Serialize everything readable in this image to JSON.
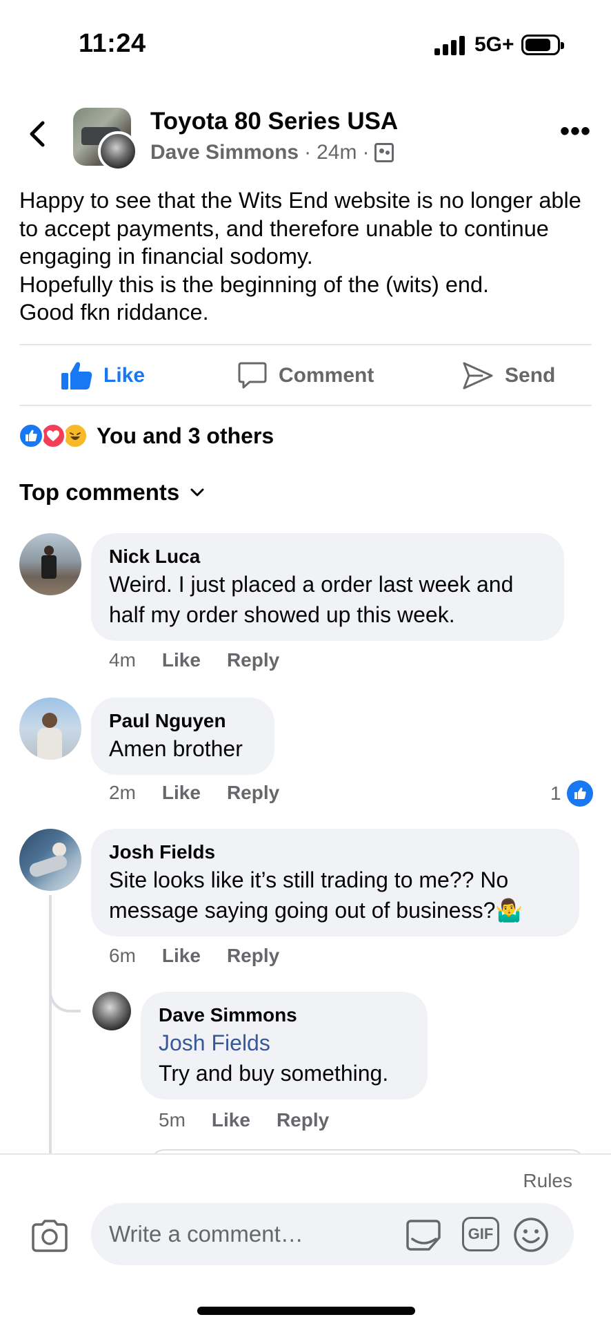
{
  "status_bar": {
    "time": "11:24",
    "network": "5G+"
  },
  "post": {
    "group_name": "Toyota 80 Series USA",
    "author": "Dave Simmons",
    "time": "24m",
    "separator": "·",
    "more_label": "•••",
    "text": "Happy to see that the Wits End website is no longer able to accept payments, and therefore unable to continue engaging in financial sodomy.\nHopefully this is the beginning of the (wits) end.\nGood fkn riddance."
  },
  "actions": {
    "like": "Like",
    "comment": "Comment",
    "send": "Send",
    "like_active": true
  },
  "reactions": {
    "summary": "You and 3 others",
    "types": [
      "like",
      "love",
      "haha"
    ]
  },
  "comments_header": {
    "label": "Top comments"
  },
  "comments": [
    {
      "name": "Nick Luca",
      "text": "Weird. I just placed a order last week and half my order showed up this week.",
      "time": "4m",
      "like": "Like",
      "reply": "Reply"
    },
    {
      "name": "Paul Nguyen",
      "text": "Amen brother",
      "time": "2m",
      "like": "Like",
      "reply": "Reply",
      "reaction_count": "1"
    },
    {
      "name": "Josh Fields",
      "text": "Site looks like it’s still trading to me?? No message saying going out of business?🤷‍♂️",
      "time": "6m",
      "like": "Like",
      "reply": "Reply"
    }
  ],
  "reply": {
    "name": "Dave Simmons",
    "mention": "Josh Fields",
    "text": "Try and buy something.",
    "time": "5m",
    "like": "Like",
    "reply": "Reply"
  },
  "composer": {
    "rules": "Rules",
    "placeholder": "Write a comment…",
    "gif": "GIF"
  },
  "colors": {
    "brand_blue": "#1877f2",
    "secondary_text": "#65676b",
    "bubble_bg": "#f0f2f5",
    "love_red": "#f33e58",
    "haha_yellow": "#f7b928"
  }
}
